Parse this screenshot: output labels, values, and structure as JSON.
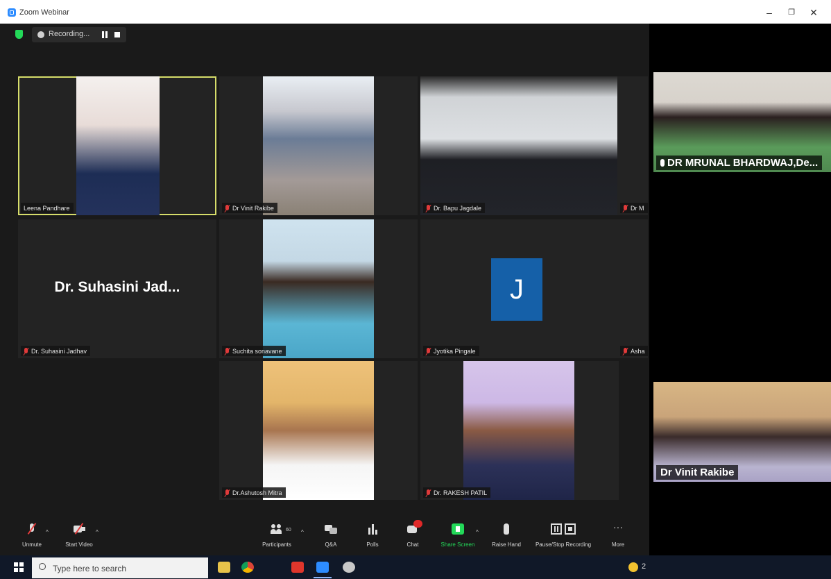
{
  "window": {
    "title": "Zoom Webinar",
    "minimize": "–",
    "restore": "❐",
    "close": "✕"
  },
  "recording": {
    "status_text": "Recording..."
  },
  "tiles": [
    {
      "name": "Leena Pandhare",
      "active": true,
      "muted": false
    },
    {
      "name": "Dr Vinit Rakibe",
      "muted": true
    },
    {
      "name": "Dr. Bapu Jagdale",
      "muted": true
    },
    {
      "name": "Dr M",
      "muted": true
    },
    {
      "name": "Dr. Suhasini Jadhav",
      "display_name": "Dr. Suhasini Jad...",
      "muted": true
    },
    {
      "name": "Suchita sonavane",
      "muted": true
    },
    {
      "name": "Jyotika Pingale",
      "avatar_letter": "J",
      "muted": true
    },
    {
      "name": "Asha",
      "muted": true
    },
    {
      "name": "Dr.Ashutosh Mitra",
      "muted": true
    },
    {
      "name": "Dr. RAKESH PATIL",
      "muted": true
    }
  ],
  "sidebar": {
    "panelists": [
      {
        "name": "DR MRUNAL BHARDWAJ,De..."
      },
      {
        "name": "Dr Vinit Rakibe"
      }
    ]
  },
  "toolbar": {
    "unmute": "Unmute",
    "start_video": "Start Video",
    "participants": "Participants",
    "participants_count": "60",
    "qa": "Q&A",
    "polls": "Polls",
    "chat": "Chat",
    "share_screen": "Share Screen",
    "raise_hand": "Raise Hand",
    "recording": "Pause/Stop Recording",
    "more": "More",
    "caret": "^"
  },
  "taskbar": {
    "search_placeholder": "Type here to search",
    "tray_text": "2"
  },
  "colors": {
    "active_border": "#d6dd6a",
    "share_green": "#23d959",
    "muted_red": "#e03a3a",
    "avatar_blue": "#1560a8"
  }
}
